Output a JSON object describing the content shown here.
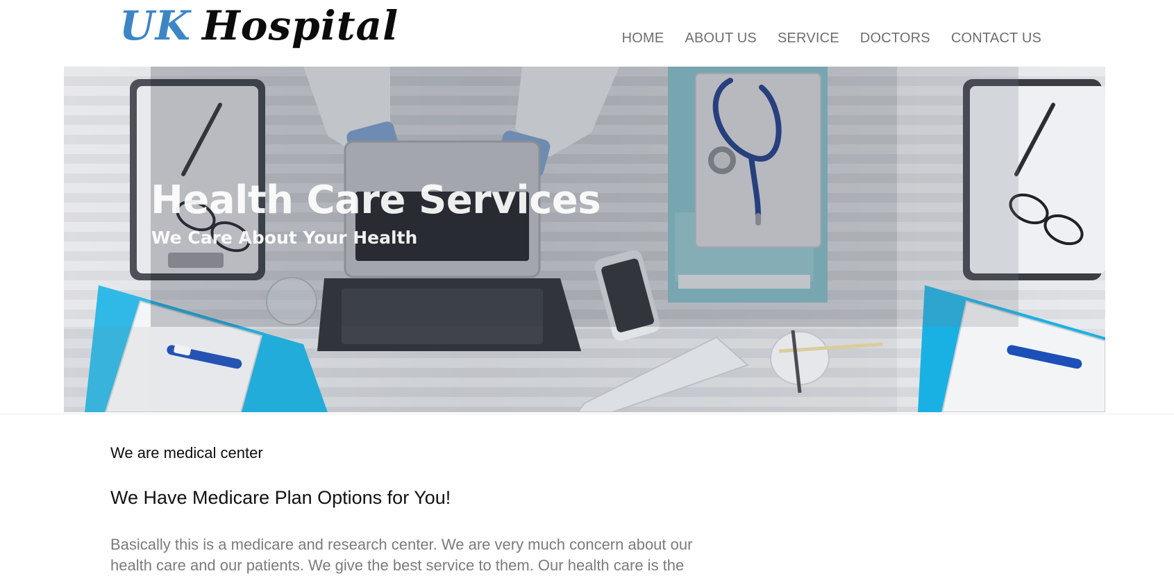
{
  "brand": {
    "logo_part1": "UK",
    "logo_part2": "Hospital",
    "accent_color": "#3d86c6",
    "dark_color": "#0b0b0b"
  },
  "nav": {
    "items": [
      {
        "label": "HOME"
      },
      {
        "label": "ABOUT US"
      },
      {
        "label": "SERVICE"
      },
      {
        "label": "DOCTORS"
      },
      {
        "label": "CONTACT US"
      }
    ]
  },
  "hero": {
    "title": "Health Care Services",
    "subtitle": "We Care About Your Health",
    "image_icons": [
      "laptop-icon",
      "stethoscope-icon",
      "clipboard-icon",
      "phone-icon",
      "keyboard-icon",
      "thermometer-icon",
      "glasses-icon"
    ]
  },
  "content": {
    "kicker": "We are medical center",
    "heading": "We Have Medicare Plan Options for You!",
    "paragraph": "Basically this is a medicare and research center. We are very much concern about our health care and our patients. We give the best service to them. Our health care is the"
  }
}
